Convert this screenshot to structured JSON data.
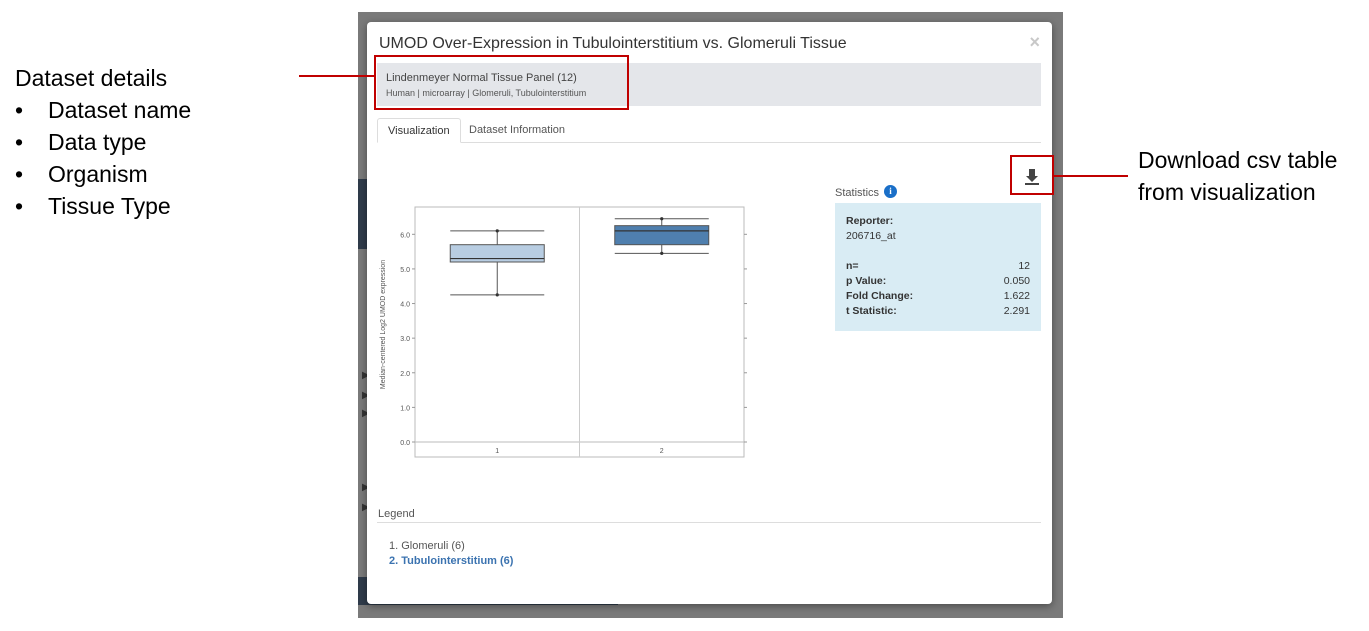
{
  "annotations": {
    "left_heading": "Dataset details",
    "left_items": [
      "Dataset name",
      "Data type",
      "Organism",
      "Tissue Type"
    ],
    "right_line1": "Download csv table",
    "right_line2": "from visualization",
    "callout_color": "#c00000"
  },
  "modal": {
    "title": "UMOD Over-Expression in Tubulointerstitium vs. Glomeruli Tissue",
    "close_icon": "×",
    "dataset": {
      "name": "Lindenmeyer Normal Tissue Panel (12)",
      "meta": "Human | microarray | Glomeruli, Tubulointerstitium"
    },
    "tabs": [
      {
        "label": "Visualization",
        "active": true
      },
      {
        "label": "Dataset Information",
        "active": false
      }
    ],
    "download_icon": "download-icon",
    "statistics": {
      "label": "Statistics",
      "info_icon": "i",
      "reporter_label": "Reporter:",
      "reporter_value": "206716_at",
      "rows": [
        {
          "key": "n=",
          "value": "12"
        },
        {
          "key": "p Value:",
          "value": "0.050"
        },
        {
          "key": "Fold Change:",
          "value": "1.622"
        },
        {
          "key": "t Statistic:",
          "value": "2.291"
        }
      ]
    },
    "legend": {
      "title": "Legend",
      "items": [
        {
          "label": "1. Glomeruli (6)",
          "selected": false
        },
        {
          "label": "2. Tubulointerstitium (6)",
          "selected": true
        }
      ]
    }
  },
  "chart_data": {
    "type": "boxplot",
    "ylabel": "Median-centered Log2 UMOD expression",
    "ylim": [
      0,
      6.5
    ],
    "yticks": [
      "0.0",
      "1.0",
      "2.0",
      "3.0",
      "4.0",
      "5.0",
      "6.0"
    ],
    "categories": [
      "1",
      "2"
    ],
    "boxes": [
      {
        "category": "1",
        "min": 4.25,
        "q1": 5.2,
        "median": 5.3,
        "q3": 5.7,
        "max": 6.1,
        "color": "#b8cde2"
      },
      {
        "category": "2",
        "min": 5.45,
        "q1": 5.7,
        "median": 6.1,
        "q3": 6.25,
        "max": 6.45,
        "color": "#4f7fae"
      }
    ]
  }
}
